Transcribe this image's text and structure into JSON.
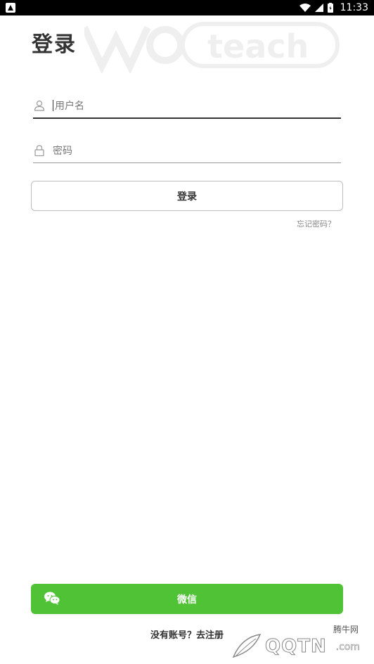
{
  "status_bar": {
    "time": "11:33"
  },
  "watermark": {
    "text": "teach"
  },
  "page": {
    "title": "登录"
  },
  "form": {
    "username_placeholder": "用户名",
    "password_placeholder": "密码",
    "login_label": "登录",
    "forgot_label": "忘记密码？"
  },
  "wechat": {
    "label": "微信"
  },
  "register": {
    "label": "没有账号？去注册"
  },
  "logo": {
    "small_text": "腾牛网",
    "big_text": "QQTN",
    "com_text": ".com"
  },
  "colors": {
    "wechat_green": "#4fc235",
    "text_dark": "#333333"
  }
}
